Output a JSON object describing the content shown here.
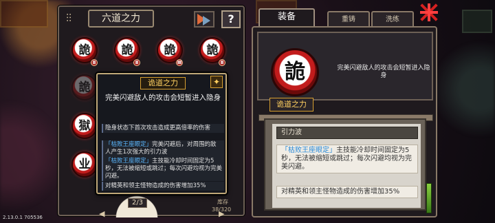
{
  "window": {
    "version": "2.13.0.1 705536"
  },
  "left_panel": {
    "title": "六道之力",
    "settings_icon": "slider-icon",
    "help_label": "?",
    "skills": [
      {
        "glyph": "詭",
        "level": "Ⅱ",
        "dim": false
      },
      {
        "glyph": "詭",
        "level": "Ⅱ",
        "dim": false
      },
      {
        "glyph": "詭",
        "level": "Ⅲ",
        "dim": false
      },
      {
        "glyph": "詭",
        "level": "Ⅱ",
        "dim": false
      },
      {
        "glyph": "詭",
        "level": "",
        "dim": true
      },
      {
        "glyph": "獄",
        "level": "",
        "dim": false
      },
      {
        "glyph": "业",
        "level": "",
        "dim": false
      }
    ],
    "page_indicator": "2/3",
    "page_label": "",
    "stock_label": "库存",
    "stock_value": "38/320"
  },
  "tooltip": {
    "title": "诡道之力",
    "star_icon": "star-icon",
    "description": "完美闪避敌人的攻击会短暂进入隐身",
    "rows": [
      {
        "text": "隐身状态下首次攻击造成更高倍率的伤害",
        "highlight": ""
      },
      {
        "highlight": "「枯败王座眼定」",
        "text": "完美闪避后，对周围的敌人产生1次强大的引力波"
      },
      {
        "highlight": "「枯败王座眼定」",
        "text": "主技能冷却时间固定为5秒，无法被缩短或跳过；每次闪避均视为完美闪避。"
      },
      {
        "highlight": "",
        "text": "对精英和领主怪物造成的伤害增加35%"
      }
    ]
  },
  "right_panel": {
    "tabs": [
      {
        "label": "装备",
        "active": true
      },
      {
        "label": "重铸",
        "active": false
      },
      {
        "label": "洗练",
        "active": false
      }
    ],
    "big_skill_glyph": "詭",
    "card_description": "完美闪避敌人的攻击会短暂进入隐身",
    "skill_name": "诡道之力",
    "entries": [
      {
        "highlight": "",
        "text": "引力波",
        "style": "fx"
      },
      {
        "highlight": "「枯败王座眼定」",
        "text": "主技能冷却时间固定为5秒，无法被缩短或跳过；每次闪避均视为完美闪避。",
        "style": "entry"
      },
      {
        "highlight": "",
        "text": "对精英和领主怪物造成的伤害增加35%",
        "style": "entry"
      }
    ]
  },
  "colors": {
    "accent_gold": "#d8a030",
    "highlight_blue": "#2a8ad8",
    "skill_red": "#c21c1c",
    "close_red": "#d42020"
  }
}
